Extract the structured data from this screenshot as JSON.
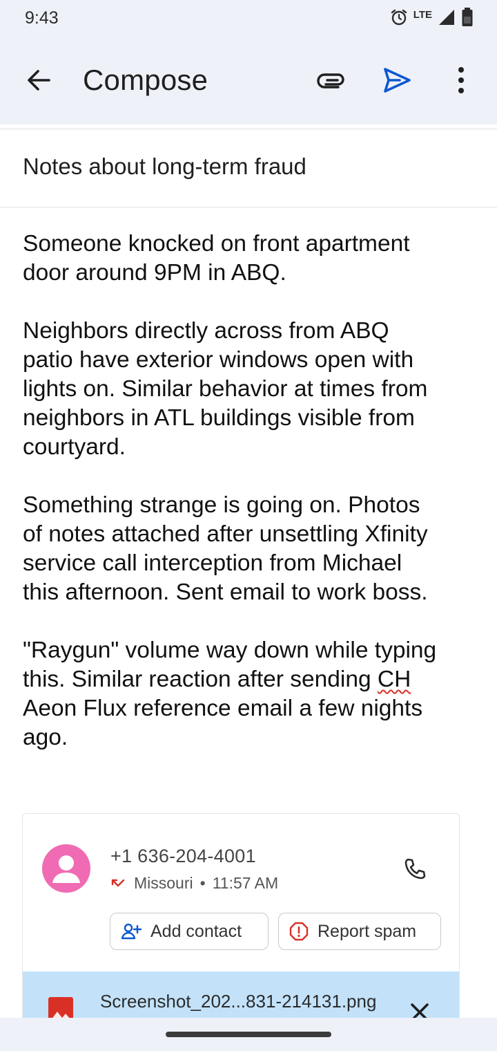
{
  "status_bar": {
    "time": "9:43",
    "network": "LTE",
    "icons": [
      "alarm-icon",
      "signal-icon",
      "battery-icon"
    ]
  },
  "app_bar": {
    "title": "Compose",
    "actions": [
      "back-arrow-icon",
      "attach-icon",
      "send-icon",
      "more-vert-icon"
    ],
    "send_color": "#0b57d0"
  },
  "compose": {
    "subject": "Notes about long-term fraud",
    "body": {
      "p1": "Someone knocked on front apartment\ndoor around 9PM in ABQ.",
      "p2": "Neighbors directly across from ABQ\npatio have exterior windows open with\nlights on. Similar behavior at times from\nneighbors in ATL buildings visible from\ncourtyard.",
      "p3": "Something strange is going on. Photos\nof notes attached after unsettling Xfinity\nservice call interception from Michael\nthis afternoon. Sent email to work boss.",
      "p4_before": "\"Raygun\" volume way down while typing\nthis. Similar reaction after sending ",
      "p4_misspelled": "CH",
      "p4_after": "\nAeon Flux reference email a few nights\nago."
    }
  },
  "call_card": {
    "phone_number": "+1 636-204-4001",
    "call_direction_icon": "missed-call-icon",
    "location": "Missouri",
    "separator": "•",
    "time": "11:57 AM",
    "add_contact_label": "Add contact",
    "report_spam_label": "Report spam",
    "avatar_color": "#f06bb3",
    "missed_color": "#d93025"
  },
  "attachment": {
    "file_name": "Screenshot_202...831-214131.png",
    "icon": "image-file-icon",
    "background": "#c3e2fa"
  }
}
